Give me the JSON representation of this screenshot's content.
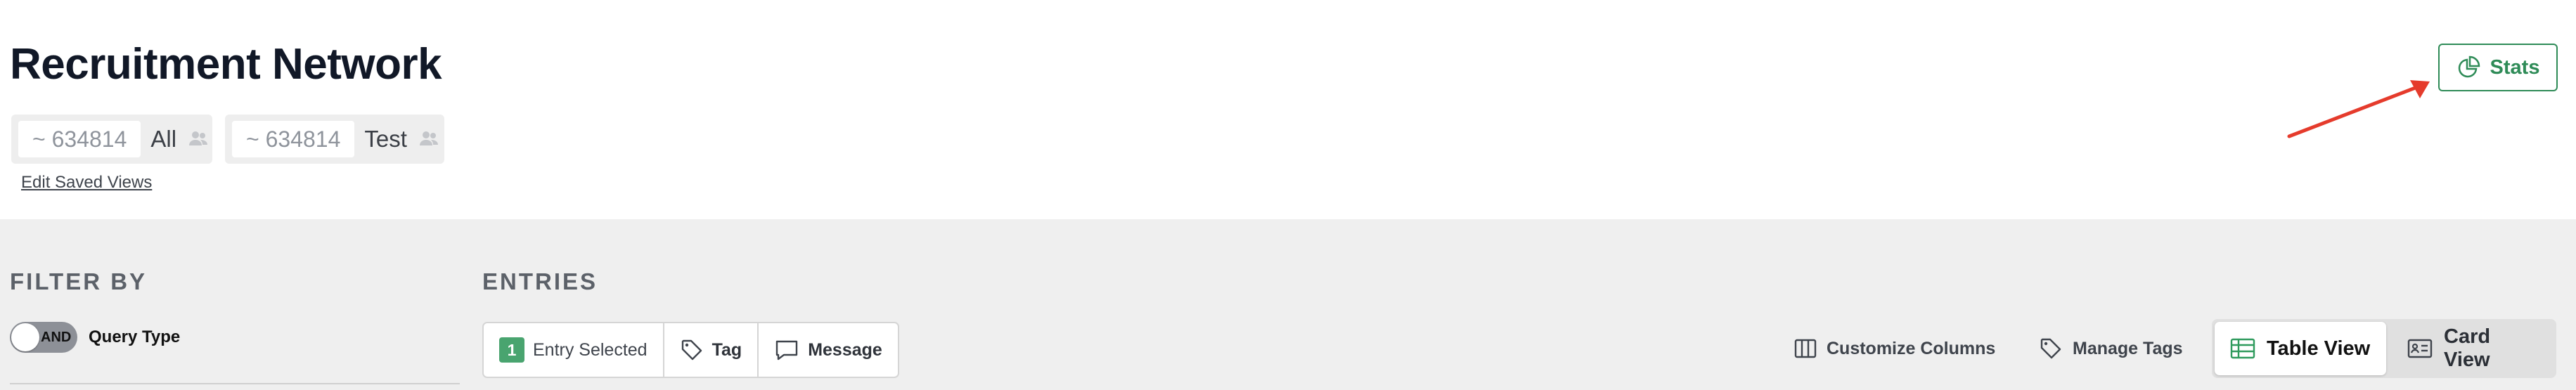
{
  "header": {
    "title": "Recruitment Network",
    "saved_views": [
      {
        "count": "~ 634814",
        "name": "All"
      },
      {
        "count": "~ 634814",
        "name": "Test"
      }
    ],
    "edit_saved_views": "Edit Saved Views",
    "stats_label": "Stats"
  },
  "filter": {
    "title": "FILTER BY",
    "toggle_value": "AND",
    "query_type_label": "Query Type"
  },
  "entries": {
    "title": "ENTRIES",
    "selected_count": "1",
    "selected_label": "Entry Selected",
    "tag_label": "Tag",
    "message_label": "Message",
    "customize_columns_label": "Customize Columns",
    "manage_tags_label": "Manage Tags",
    "table_view_label": "Table View",
    "card_view_label": "Card View"
  },
  "colors": {
    "accent_green": "#2e8b57",
    "badge_green": "#49a46f",
    "annotation_arrow": "#e53b2c"
  },
  "icons": [
    "pie-chart-icon",
    "people-icon",
    "tag-icon",
    "message-icon",
    "columns-icon",
    "table-icon",
    "card-icon"
  ]
}
